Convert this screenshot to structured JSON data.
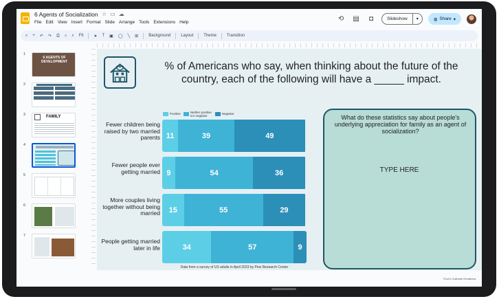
{
  "app": {
    "doc_title": "6 Agents of Socialization",
    "menus": [
      "File",
      "Edit",
      "View",
      "Insert",
      "Format",
      "Slide",
      "Arrange",
      "Tools",
      "Extensions",
      "Help"
    ],
    "slideshow_label": "Slideshow",
    "share_label": "Share"
  },
  "toolbar": {
    "fit_label": "Fit",
    "background_label": "Background",
    "layout_label": "Layout",
    "theme_label": "Theme",
    "transition_label": "Transition"
  },
  "filmstrip": {
    "selected_index": 4,
    "slides": [
      {
        "num": "1",
        "title": "6 AGENTS OF DEVELOPMENT"
      },
      {
        "num": "2",
        "title": "6 AGENTS OF SOCIALIZATION",
        "items": [
          "FAMILY",
          "MEDIA",
          "SCHOOL",
          "RELIGION",
          "PEERS",
          "WORK"
        ]
      },
      {
        "num": "3",
        "title": "FAMILY"
      },
      {
        "num": "4"
      },
      {
        "num": "5"
      },
      {
        "num": "6"
      },
      {
        "num": "7"
      }
    ]
  },
  "slide": {
    "title": "% of Americans who say, when thinking about the future of the country, each of the following will have a _____ impact.",
    "source": "Data from a survey of US adults in April 2023 by Pew Research Center",
    "question": "What do these statistics say about people's underlying appreciation for family as an agent of socialization?",
    "answer_placeholder": "TYPE HERE",
    "copyright": "©Let's Cultivate Greatness"
  },
  "colors": {
    "positive": "#5ccfe6",
    "neither": "#3eb3d6",
    "negative": "#2b8fb8",
    "outline": "#1f5566",
    "question_box": "#b8dcd6",
    "slide_bg": "#e6f0f3"
  },
  "chart_data": {
    "type": "bar",
    "stacked": true,
    "orientation": "horizontal",
    "categories": [
      "Fewer children being raised by two married parents",
      "Fewer people ever getting married",
      "More couples living together without being married",
      "People getting married later in life"
    ],
    "series": [
      {
        "name": "Positive",
        "values": [
          11,
          9,
          15,
          34
        ]
      },
      {
        "name": "Neither positive nor negative",
        "values": [
          39,
          54,
          55,
          57
        ]
      },
      {
        "name": "Negative",
        "values": [
          49,
          36,
          29,
          9
        ]
      }
    ],
    "legend": "top"
  }
}
